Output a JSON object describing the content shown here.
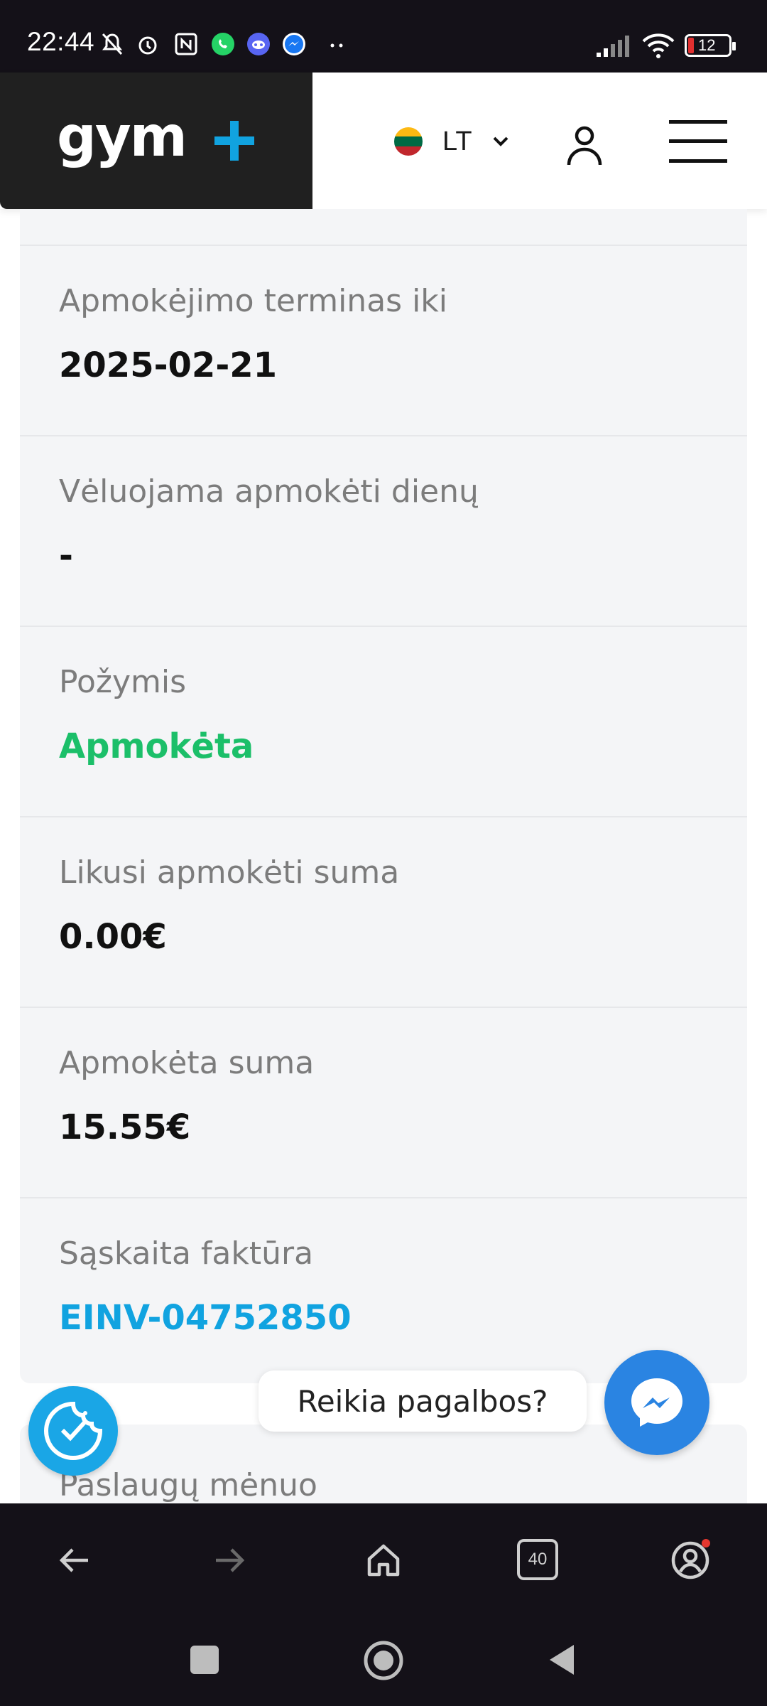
{
  "status_bar": {
    "time": "22:44",
    "battery": "12"
  },
  "header": {
    "logo_text": "gym",
    "language": "LT",
    "flag_colors": [
      "#fdb913",
      "#006a44",
      "#c1272d"
    ]
  },
  "details": [
    {
      "label": "Apmokėjimo terminas iki",
      "value": "2025-02-21",
      "style": "normal"
    },
    {
      "label": "Vėluojama apmokėti dienų",
      "value": "-",
      "style": "normal"
    },
    {
      "label": "Požymis",
      "value": "Apmokėta",
      "style": "green"
    },
    {
      "label": "Likusi apmokėti suma",
      "value": "0.00€",
      "style": "normal"
    },
    {
      "label": "Apmokėta suma",
      "value": "15.55€",
      "style": "normal"
    },
    {
      "label": "Sąskaita faktūra",
      "value": "EINV-04752850",
      "style": "blue"
    }
  ],
  "next_card": {
    "label": "Paslaugų mėnuo"
  },
  "help": {
    "label": "Reikia pagalbos?"
  },
  "browser": {
    "tab_count": "40"
  },
  "colors": {
    "accent_blue": "#11a3e0",
    "paid_green": "#1bbf69",
    "messenger": "#2a84e2"
  }
}
